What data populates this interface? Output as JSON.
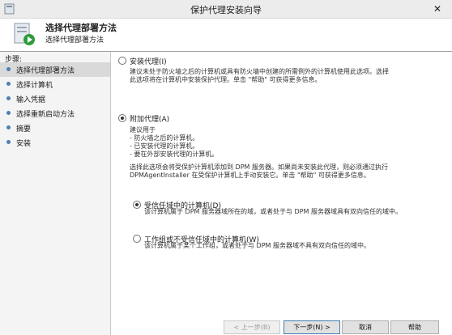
{
  "window": {
    "title": "保护代理安装向导",
    "close_glyph": "✕"
  },
  "header": {
    "title": "选择代理部署方法",
    "subtitle": "选择代理部署方法"
  },
  "sidebar": {
    "steps_label": "步骤:",
    "items": [
      {
        "label": "选择代理部署方法",
        "active": true
      },
      {
        "label": "选择计算机"
      },
      {
        "label": "输入凭据"
      },
      {
        "label": "选择重新启动方法"
      },
      {
        "label": "摘要"
      },
      {
        "label": "安装"
      }
    ]
  },
  "options": {
    "install": {
      "label": "安装代理(I)",
      "desc_line1": "建议未处于防火墙之后的计算机或具有防火墙中创建的所需例外的计算机使用此选项。选择",
      "desc_line2": "此选项将在计算机中安装保护代理。单击 \"帮助\" 可获得更多信息。",
      "selected": false
    },
    "attach": {
      "label": "附加代理(A)",
      "desc_line1": "建议用于",
      "desc_line2": "- 防火墙之后的计算机。",
      "desc_line3": "- 已安装代理的计算机。",
      "desc_line4": "- 要在外部安装代理的计算机。",
      "desc_line5": "选择此选项会将受保护计算机添加到 DPM 服务器。如果尚未安装此代理，则必须通过执行",
      "desc_line6": "DPMAgentInstaller 在受保护计算机上手动安装它。单击 \"帮助\" 可获得更多信息。",
      "selected": true,
      "sub": {
        "trusted": {
          "label": "受信任域中的计算机(D)",
          "desc": "该计算机属于 DPM 服务器域所在的域，或者处于与 DPM 服务器域具有双向信任的域中。",
          "selected": true
        },
        "untrusted": {
          "label": "工作组或不受信任域中的计算机(W)",
          "desc": "该计算机属于某个工作组，或者处于与 DPM 服务器域不具有双向信任的域中。",
          "selected": false
        }
      }
    }
  },
  "buttons": {
    "back": "< 上一步(B)",
    "next": "下一步(N) >",
    "cancel": "取消",
    "help": "帮助"
  }
}
